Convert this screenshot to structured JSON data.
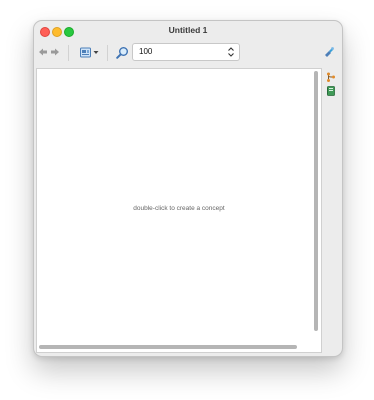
{
  "window": {
    "title": "Untitled 1"
  },
  "toolbar": {
    "back_icon": "back-arrow-icon",
    "forward_icon": "forward-arrow-icon",
    "view_menu_icon": "view-menu-icon",
    "zoom_icon": "magnifier-icon",
    "zoom_value": "100",
    "right_icon": "tools-icon"
  },
  "canvas": {
    "hint": "double-click to create a concept"
  },
  "sidebar": {
    "items": [
      {
        "icon": "branch-icon"
      },
      {
        "icon": "notebook-icon"
      }
    ]
  },
  "colors": {
    "close": "#ff5f57",
    "minimize": "#febc2e",
    "maximize": "#28c840",
    "window_bg": "#ececec"
  }
}
